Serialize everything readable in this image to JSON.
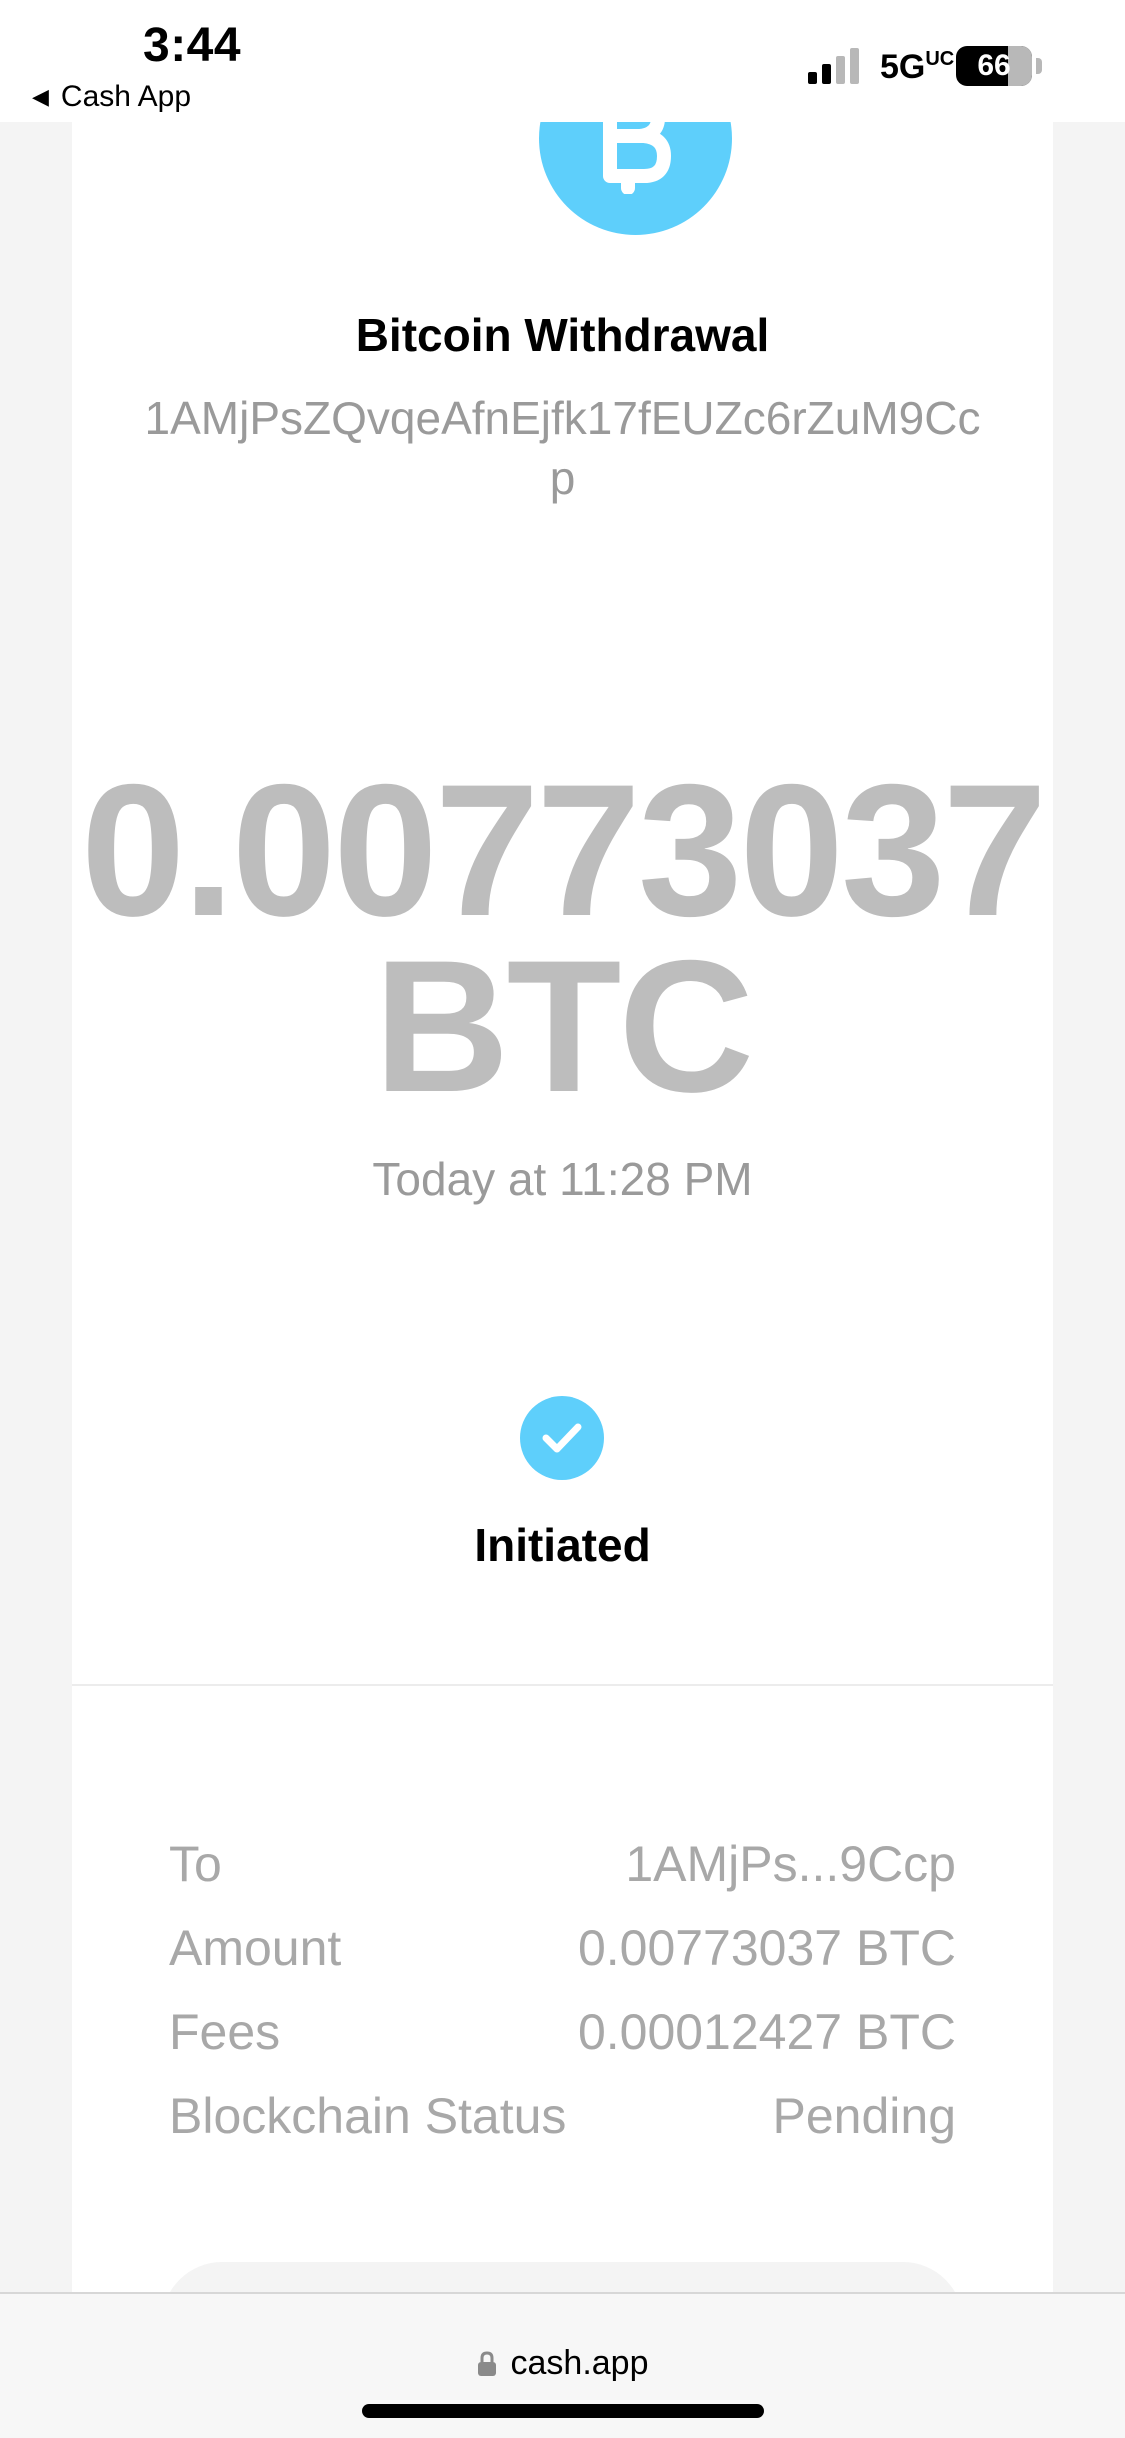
{
  "status_bar": {
    "time": "3:44",
    "back_label": "Cash App",
    "network": "5G",
    "network_suffix": "UC",
    "battery": "66"
  },
  "transaction": {
    "title": "Bitcoin Withdrawal",
    "address": "1AMjPsZQvqeAfnEjfk17fEUZc6rZuM9Ccp",
    "amount_value": "0.00773037",
    "amount_unit": "BTC",
    "datetime": "Today at 11:28 PM",
    "status": "Initiated"
  },
  "details": [
    {
      "label": "To",
      "value": "1AMjPs...9Ccp"
    },
    {
      "label": "Amount",
      "value": "0.00773037 BTC"
    },
    {
      "label": "Fees",
      "value": "0.00012427 BTC"
    },
    {
      "label": "Blockchain Status",
      "value": "Pending"
    }
  ],
  "browser": {
    "url": "cash.app"
  },
  "colors": {
    "accent": "#5ecffb",
    "muted_text": "#9a9a9a",
    "amount_text": "#bdbdbd"
  },
  "icons": {
    "bitcoin": "bitcoin-icon",
    "check": "check-icon",
    "lock": "lock-icon",
    "back": "back-arrow-icon",
    "signal": "cellular-signal-icon",
    "battery": "battery-icon"
  }
}
